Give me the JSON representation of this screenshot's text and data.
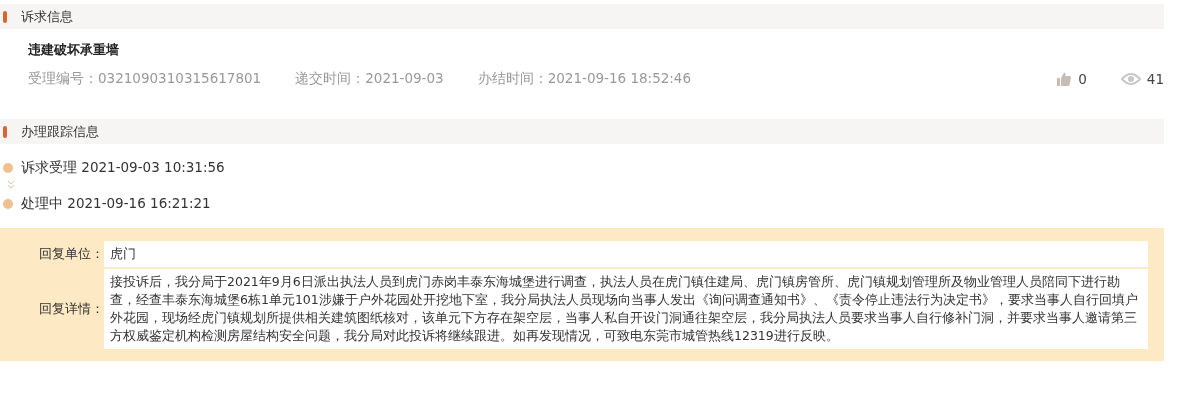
{
  "complaint_section": {
    "title": "诉求信息"
  },
  "complaint": {
    "subject": "违建破坏承重墙",
    "fields": [
      {
        "label": "受理编号：",
        "value": "0321090310315617801"
      },
      {
        "label": "递交时间：",
        "value": "2021-09-03"
      },
      {
        "label": "办结时间：",
        "value": "2021-09-16 18:52:46"
      }
    ],
    "likes": "0",
    "views": "41"
  },
  "tracking_section": {
    "title": "办理跟踪信息"
  },
  "timeline": [
    {
      "status": "诉求受理",
      "time": "2021-09-03 10:31:56"
    },
    {
      "status": "处理中",
      "time": "2021-09-16 16:21:21"
    }
  ],
  "reply": [
    {
      "label": "回复单位：",
      "value": "虎门"
    },
    {
      "label": "回复详情：",
      "value": "接投诉后，我分局于2021年9月6日派出执法人员到虎门赤岗丰泰东海城堡进行调查，执法人员在虎门镇住建局、虎门镇房管所、虎门镇规划管理所及物业管理人员陪同下进行勘查，经查丰泰东海城堡6栋1单元101涉嫌于户外花园处开挖地下室，我分局执法人员现场向当事人发出《询问调查通知书》、《责令停止违法行为决定书》，要求当事人自行回填户外花园，现场经虎门镇规划所提供相关建筑图纸核对，该单元下方存在架空层，当事人私自开设门洞通往架空层，我分局执法人员要求当事人自行修补门洞，并要求当事人邀请第三方权威鉴定机构检测房屋结构安全问题，我分局对此投诉将继续跟进。如再发现情况，可致电东莞市城管热线12319进行反映。"
    }
  ]
}
